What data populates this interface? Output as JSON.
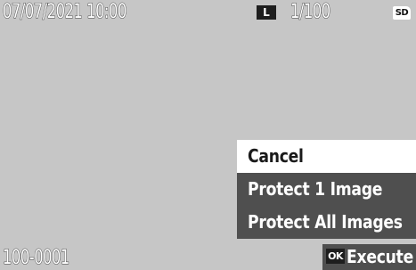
{
  "status_bar": {
    "datetime": "07/07/2021 10:00",
    "image_size": "L",
    "frame_count": "1/100",
    "card": "SD"
  },
  "footer": {
    "file_number": "100-0001",
    "ok_key": "OK",
    "execute_label": "Execute"
  },
  "menu": {
    "items": [
      {
        "label": "Cancel",
        "selected": true
      },
      {
        "label": "Protect 1 Image",
        "selected": false
      },
      {
        "label": "Protect All Images",
        "selected": false
      }
    ]
  },
  "colors": {
    "screen_background": "#c6c6c6",
    "menu_background": "#4f4f4f",
    "menu_selected_background": "#ffffff",
    "badge_background": "#1e1e1e"
  }
}
